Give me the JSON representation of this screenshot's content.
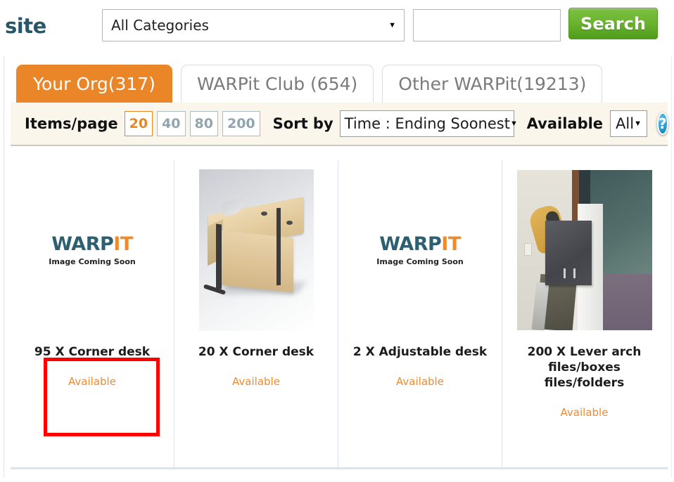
{
  "header": {
    "logo_text": "site",
    "category_select": {
      "value": "All Categories",
      "caret_icon": "chevron-down-icon"
    },
    "search_input": {
      "value": "",
      "placeholder": ""
    },
    "search_button_label": "Search"
  },
  "tabs": [
    {
      "label": "Your Org(317)",
      "active": true
    },
    {
      "label": "WARPit Club (654)",
      "active": false
    },
    {
      "label": "Other WARPit(19213)",
      "active": false
    }
  ],
  "toolbar": {
    "items_per_page_label": "Items/page",
    "items_per_page_options": [
      "20",
      "40",
      "80",
      "200"
    ],
    "items_per_page_selected": "20",
    "sort_by_label": "Sort by",
    "sort_by_value": "Time : Ending Soonest",
    "available_label": "Available",
    "available_value": "All",
    "help_icon_label": "?",
    "caret_icon": "chevron-down-icon"
  },
  "products": [
    {
      "title": "95 X Corner desk",
      "status": "Available",
      "media": "placeholder",
      "placeholder": {
        "word_a": "WARP",
        "word_b": "IT",
        "subtitle": "Image Coming Soon"
      },
      "highlighted": true
    },
    {
      "title": "20 X Corner desk",
      "status": "Available",
      "media": "desk-photo",
      "highlighted": false
    },
    {
      "title": "2 X Adjustable desk",
      "status": "Available",
      "media": "placeholder",
      "placeholder": {
        "word_a": "WARP",
        "word_b": "IT",
        "subtitle": "Image Coming Soon"
      },
      "highlighted": false
    },
    {
      "title": "200 X Lever arch files/boxes files/folders",
      "status": "Available",
      "media": "file-photo",
      "highlighted": false
    }
  ],
  "colors": {
    "accent_orange": "#ea8628",
    "search_green": "#6ab32f",
    "logo_teal": "#2a5767",
    "toolbar_cream": "#faf6ec",
    "divider_blue": "#dae3f1",
    "annotation_red": "#fe0000",
    "help_blue": "#2ba0db"
  }
}
